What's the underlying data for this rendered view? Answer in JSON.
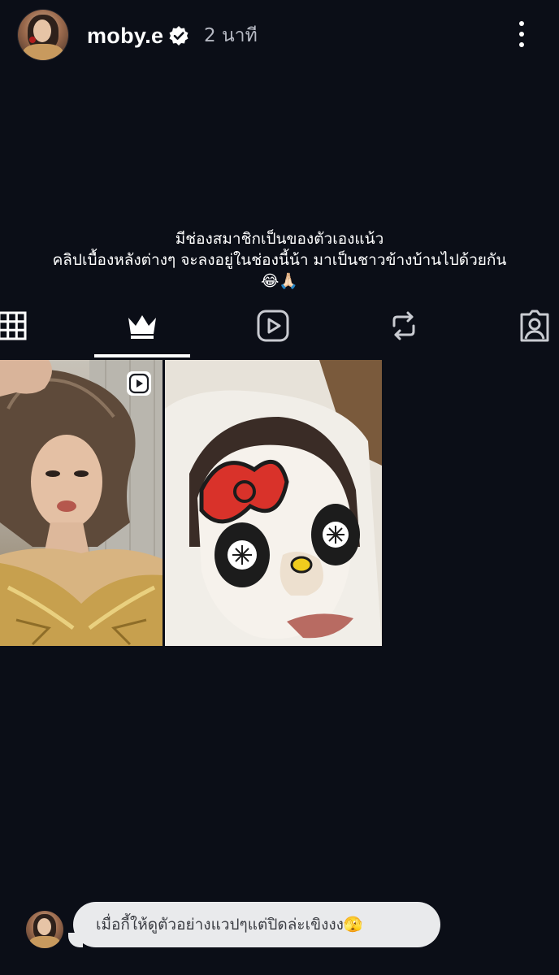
{
  "header": {
    "username": "moby.e",
    "timestamp": "2 นาที"
  },
  "bio": {
    "line1": "มีช่องสมาชิกเป็นของตัวเองแน้ว",
    "line2": "คลิปเบื้องหลังต่างๆ จะลงอยู่ในช่องนี้น้า มาเป็นชาวข้างบ้านไปด้วยกัน",
    "line3": "😂🙏🏻"
  },
  "tabs": [
    {
      "name": "grid",
      "icon": "grid-icon",
      "active": false
    },
    {
      "name": "subscriptions",
      "icon": "crown-icon",
      "active": true
    },
    {
      "name": "reels",
      "icon": "reels-icon",
      "active": false
    },
    {
      "name": "reposts",
      "icon": "repost-icon",
      "active": false
    },
    {
      "name": "tagged",
      "icon": "tagged-icon",
      "active": false
    }
  ],
  "posts": [
    {
      "type": "video",
      "icon": "video-badge-icon"
    },
    {
      "type": "photo"
    }
  ],
  "comment": {
    "text": "เมื่อกี้ให้ดูตัวอย่างแวปๆแต่ปิดล่ะเขิงงง🫣"
  },
  "colors": {
    "background": "#0b0e17",
    "verified_badge": "#ffffff",
    "bubble": "#e9eaec"
  }
}
